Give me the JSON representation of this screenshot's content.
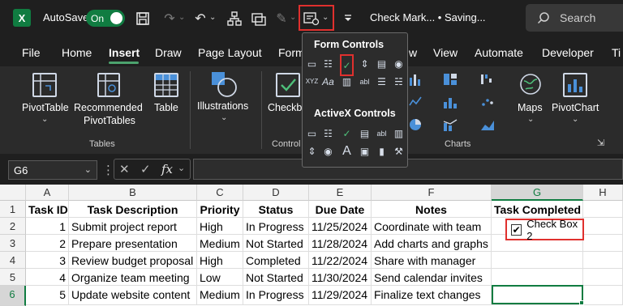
{
  "titlebar": {
    "app_letter": "X",
    "autosave_label": "AutoSave",
    "toggle_label": "On",
    "doc_title": "Check Mark... • Saving...",
    "search_placeholder": "Search"
  },
  "tabs": [
    "File",
    "Home",
    "Insert",
    "Draw",
    "Page Layout",
    "Form",
    "w",
    "View",
    "Automate",
    "Developer",
    "Ti"
  ],
  "active_tab": "Insert",
  "ribbon": {
    "pivottable": "PivotTable",
    "recommended_1": "Recommended",
    "recommended_2": "PivotTables",
    "table": "Table",
    "illustrations": "Illustrations",
    "checkbox": "Checkb",
    "maps": "Maps",
    "pivotchart": "PivotChart",
    "group_tables": "Tables",
    "group_controls": "Control",
    "group_charts": "Charts"
  },
  "dropdown": {
    "form_controls": "Form Controls",
    "activex_controls": "ActiveX Controls",
    "xyz_label": "XYZ",
    "aa_label": "Aa",
    "abl_label": "abl"
  },
  "formula_bar": {
    "name_box": "G6",
    "fx": "fx",
    "value": ""
  },
  "sheet": {
    "columns": [
      "A",
      "B",
      "C",
      "D",
      "E",
      "F",
      "G",
      "H"
    ],
    "rows": [
      "1",
      "2",
      "3",
      "4",
      "5",
      "6"
    ],
    "headers": [
      "Task ID",
      "Task Description",
      "Priority",
      "Status",
      "Due Date",
      "Notes",
      "Task Completed"
    ],
    "data": [
      [
        "1",
        "Submit project report",
        "High",
        "In Progress",
        "11/25/2024",
        "Coordinate with team"
      ],
      [
        "2",
        "Prepare presentation",
        "Medium",
        "Not Started",
        "11/28/2024",
        "Add charts and graphs"
      ],
      [
        "3",
        "Review budget proposal",
        "High",
        "Completed",
        "11/22/2024",
        "Share with manager"
      ],
      [
        "4",
        "Organize team meeting",
        "Low",
        "Not Started",
        "11/30/2024",
        "Send calendar invites"
      ],
      [
        "5",
        "Update website content",
        "Medium",
        "In Progress",
        "11/29/2024",
        "Finalize text changes"
      ]
    ],
    "checkbox_label": "Check Box 2",
    "selected_cell": "G6"
  },
  "colors": {
    "excel_green": "#107c41",
    "highlight_red": "#e0302e",
    "dark_bg": "#1f1f1f",
    "ribbon_bg": "#2b2b2b"
  },
  "icons": {
    "save": "save-icon",
    "undo": "undo-icon",
    "redo": "redo-icon",
    "controls": "controls-icon",
    "search": "search-icon"
  }
}
